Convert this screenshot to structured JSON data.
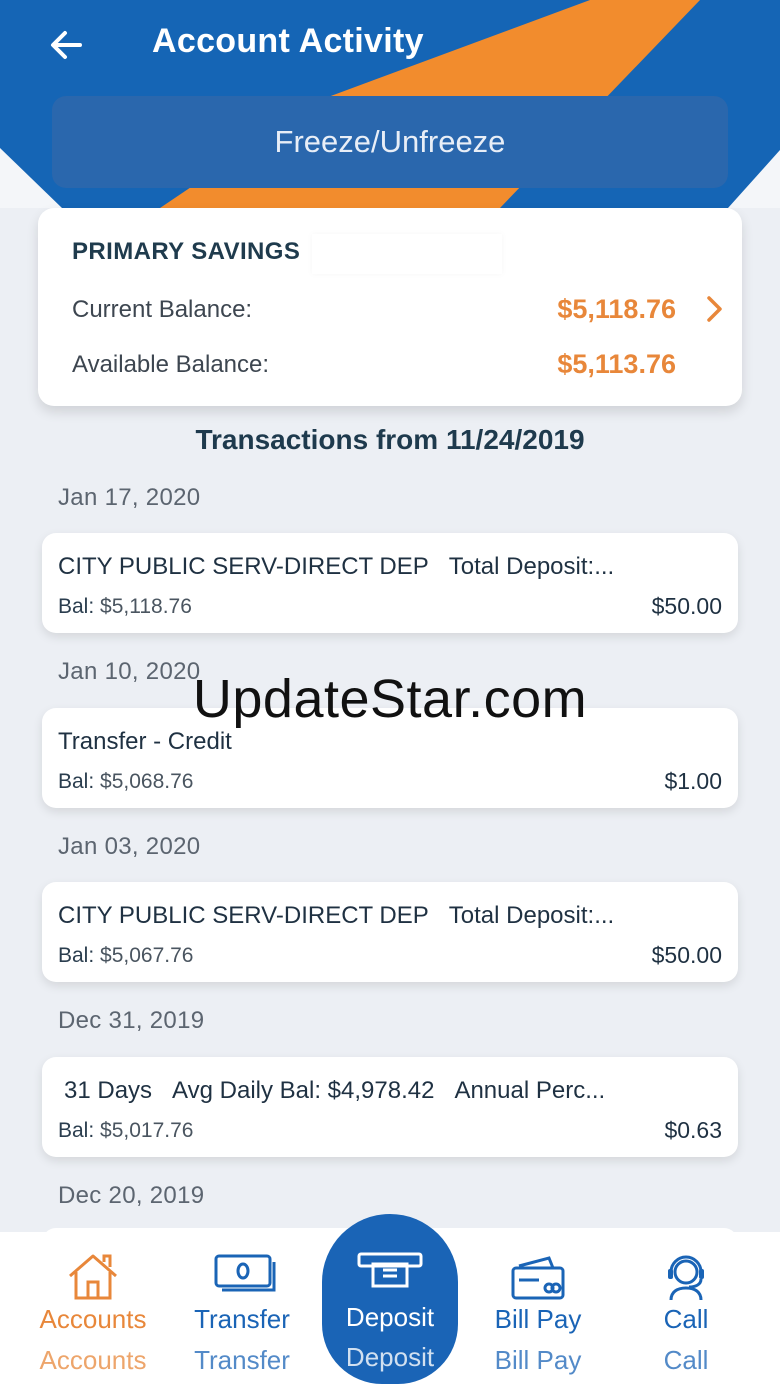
{
  "header": {
    "title": "Account Activity",
    "freeze_label": "Freeze/Unfreeze"
  },
  "account": {
    "name": "PRIMARY SAVINGS",
    "current_label": "Current Balance:",
    "current_value": "$5,118.76",
    "available_label": "Available Balance:",
    "available_value": "$5,113.76"
  },
  "transactions_heading": "Transactions from 11/24/2019",
  "transactions": [
    {
      "date": "Jan 17, 2020",
      "desc": "CITY PUBLIC SERV-DIRECT DEP",
      "desc2": "Total Deposit:...",
      "bal_label": "Bal:",
      "bal": "$5,118.76",
      "amount": "$50.00"
    },
    {
      "date": "Jan 10, 2020",
      "desc": "Transfer - Credit",
      "desc2": "",
      "bal_label": "Bal:",
      "bal": "$5,068.76",
      "amount": "$1.00"
    },
    {
      "date": "Jan 03, 2020",
      "desc": "CITY PUBLIC SERV-DIRECT DEP",
      "desc2": "Total Deposit:...",
      "bal_label": "Bal:",
      "bal": "$5,067.76",
      "amount": "$50.00"
    },
    {
      "date": "Dec 31, 2019",
      "desc": "31 Days",
      "desc2": "Avg Daily Bal: $4,978.42",
      "desc3": "Annual Perc...",
      "bal_label": "Bal:",
      "bal": "$5,017.76",
      "amount": "$0.63"
    }
  ],
  "next_date": "Dec 20, 2019",
  "watermark": "UpdateStar.com",
  "nav": [
    {
      "label": "Accounts",
      "icon": "home-icon",
      "color": "#e8873a"
    },
    {
      "label": "Transfer",
      "icon": "money-icon",
      "color": "#1a64b6"
    },
    {
      "label": "Deposit",
      "icon": "deposit-icon",
      "color": "#ffffff"
    },
    {
      "label": "Bill Pay",
      "icon": "credit-card-icon",
      "color": "#1a64b6"
    },
    {
      "label": "Call",
      "icon": "headset-icon",
      "color": "#1a64b6"
    }
  ],
  "colors": {
    "brand_blue": "#1565b5",
    "accent_orange": "#f28c2d",
    "balance_orange": "#e8873a"
  }
}
